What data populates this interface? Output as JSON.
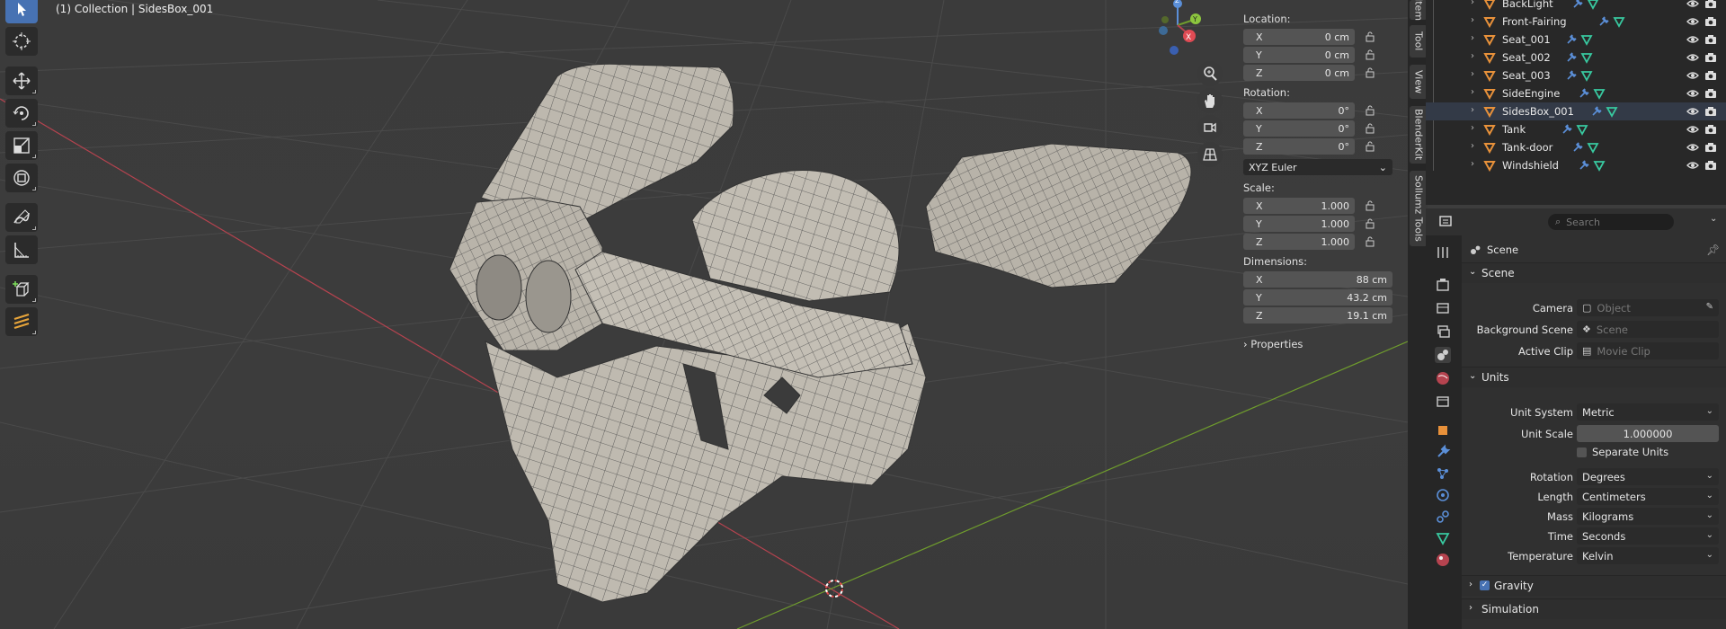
{
  "viewport": {
    "title": "(1) Collection | SidesBox_001",
    "tools": [
      "select-tool",
      "cursor-tool",
      "move-tool",
      "rotate-tool",
      "scale-tool",
      "transform-tool",
      "annotate-tool",
      "measure-tool",
      "add-cube-tool",
      "grease-pencil-tool"
    ],
    "gizmo": {
      "x_label": "X",
      "y_label": "Y",
      "z_label": "Z"
    }
  },
  "npanel": {
    "location_label": "Location:",
    "location": [
      {
        "axis": "X",
        "value": "0 cm"
      },
      {
        "axis": "Y",
        "value": "0 cm"
      },
      {
        "axis": "Z",
        "value": "0 cm"
      }
    ],
    "rotation_label": "Rotation:",
    "rotation": [
      {
        "axis": "X",
        "value": "0°"
      },
      {
        "axis": "Y",
        "value": "0°"
      },
      {
        "axis": "Z",
        "value": "0°"
      }
    ],
    "rotation_mode": "XYZ Euler",
    "scale_label": "Scale:",
    "scale": [
      {
        "axis": "X",
        "value": "1.000"
      },
      {
        "axis": "Y",
        "value": "1.000"
      },
      {
        "axis": "Z",
        "value": "1.000"
      }
    ],
    "dimensions_label": "Dimensions:",
    "dimensions": [
      {
        "axis": "X",
        "value": "88 cm"
      },
      {
        "axis": "Y",
        "value": "43.2 cm"
      },
      {
        "axis": "Z",
        "value": "19.1 cm"
      }
    ],
    "properties_label": "Properties",
    "tabs": [
      "Item",
      "Tool",
      "View",
      "BlenderKit",
      "Sollumz Tools"
    ]
  },
  "outliner": {
    "items": [
      {
        "name": "BackLight",
        "selected": false
      },
      {
        "name": "Front-Fairing",
        "selected": false
      },
      {
        "name": "Seat_001",
        "selected": false
      },
      {
        "name": "Seat_002",
        "selected": false
      },
      {
        "name": "Seat_003",
        "selected": false
      },
      {
        "name": "SideEngine",
        "selected": false
      },
      {
        "name": "SidesBox_001",
        "selected": true
      },
      {
        "name": "Tank",
        "selected": false
      },
      {
        "name": "Tank-door",
        "selected": false
      },
      {
        "name": "Windshield",
        "selected": false
      }
    ]
  },
  "properties": {
    "search_placeholder": "Search",
    "breadcrumb": "Scene",
    "scene_section": "Scene",
    "camera_label": "Camera",
    "camera_placeholder": "Object",
    "background_scene_label": "Background Scene",
    "background_scene_placeholder": "Scene",
    "active_clip_label": "Active Clip",
    "active_clip_placeholder": "Movie Clip",
    "units_section": "Units",
    "unit_system_label": "Unit System",
    "unit_system": "Metric",
    "unit_scale_label": "Unit Scale",
    "unit_scale": "1.000000",
    "separate_units_label": "Separate Units",
    "separate_units": false,
    "rotation_label": "Rotation",
    "rotation": "Degrees",
    "length_label": "Length",
    "length": "Centimeters",
    "mass_label": "Mass",
    "mass": "Kilograms",
    "time_label": "Time",
    "time": "Seconds",
    "temperature_label": "Temperature",
    "temperature": "Kelvin",
    "gravity_section": "Gravity",
    "gravity": true,
    "simulation_section": "Simulation"
  },
  "colors": {
    "x_axis": "#b5434f",
    "y_axis": "#6f9c2d",
    "active_tool": "#4772b3",
    "mesh_fill": "#bdb8ae",
    "mesh_wire": "#3a3a3a",
    "object_icon": "#e8913a",
    "modifier_icon": "#5b8fd8",
    "mesh_icon": "#38c9a0"
  }
}
